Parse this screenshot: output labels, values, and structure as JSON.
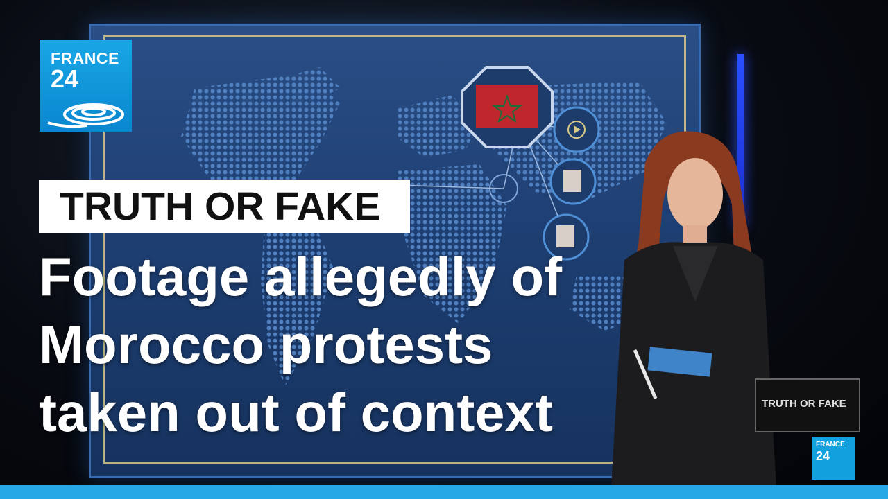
{
  "logo": {
    "line1": "FRANCE",
    "line2": "24"
  },
  "banner": {
    "label": "TRUTH OR FAKE"
  },
  "headline": {
    "line1": "Footage allegedly of",
    "line2": "Morocco protests",
    "line3": "taken out of context"
  },
  "monitor": {
    "text": "TRUTH OR FAKE"
  },
  "mini_logo": {
    "line1": "FRANCE",
    "line2": "24"
  },
  "colors": {
    "brand_blue": "#12a0de",
    "screen_blue": "#1e3f73",
    "accent_red": "#c0272d"
  }
}
